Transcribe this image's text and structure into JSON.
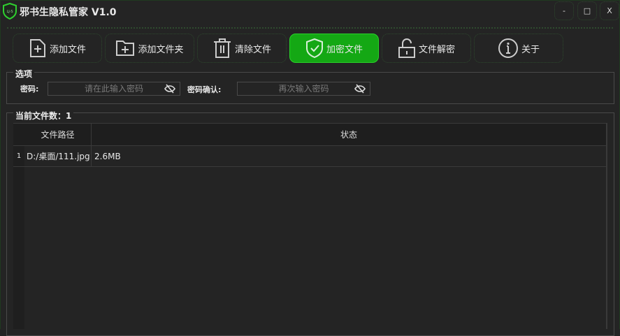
{
  "window": {
    "title": "邪书生隐私管家 V1.0",
    "logo_text": "LJ-S",
    "controls": {
      "minimize": "-",
      "maximize": "□",
      "close": "X"
    }
  },
  "toolbar": [
    {
      "label": "添加文件",
      "icon": "file-plus-icon"
    },
    {
      "label": "添加文件夹",
      "icon": "folder-plus-icon"
    },
    {
      "label": "清除文件",
      "icon": "trash-icon"
    },
    {
      "label": "加密文件",
      "icon": "shield-check-icon",
      "active": true
    },
    {
      "label": "文件解密",
      "icon": "unlock-icon"
    },
    {
      "label": "关于",
      "icon": "info-icon"
    }
  ],
  "options": {
    "group_title": "选项",
    "password_label": "密码:",
    "password_placeholder": "请在此输入密码",
    "confirm_label": "密码确认:",
    "confirm_placeholder": "再次输入密码"
  },
  "files": {
    "group_title": "当前文件数：1",
    "columns": [
      "文件路径",
      "状态"
    ],
    "rows": [
      {
        "num": "1",
        "path": "D:/桌面/111.jpg",
        "status": "2.6MB"
      }
    ]
  },
  "colors": {
    "accent": "#14a814",
    "background": "#242424"
  }
}
